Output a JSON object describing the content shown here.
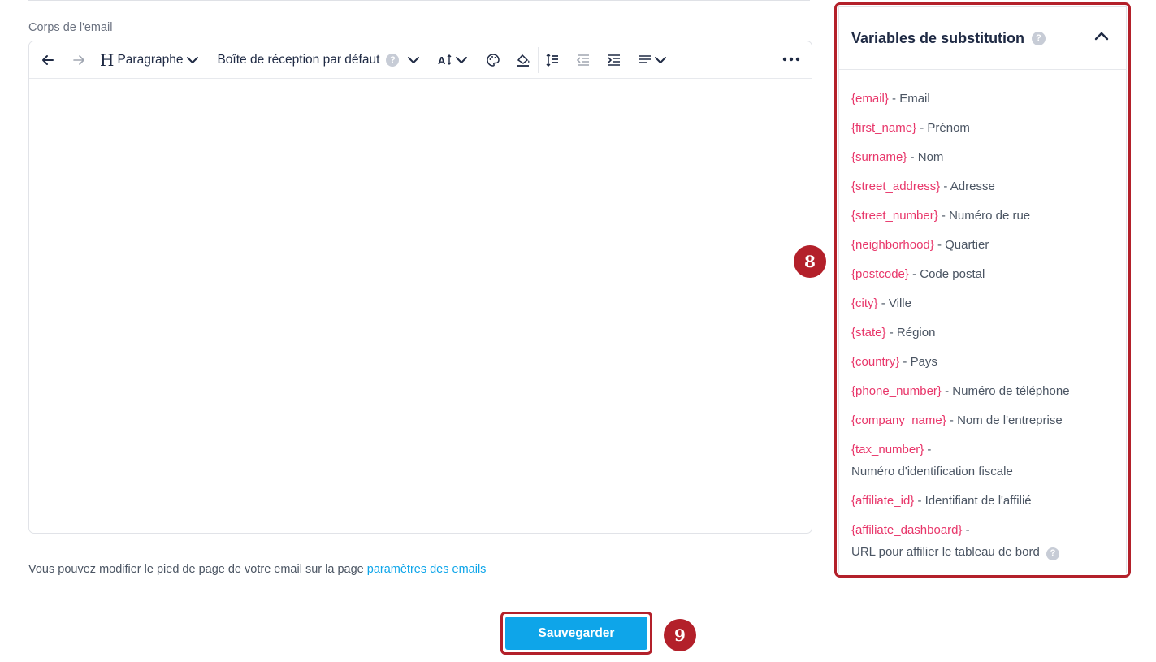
{
  "editor": {
    "label": "Corps de l'email",
    "toolbar": {
      "undo_icon": "arrow-left-icon",
      "redo_icon": "arrow-right-icon",
      "heading_icon": "heading-icon",
      "paragraph_label": "Paragraphe",
      "inbox_label": "Boîte de réception par défaut",
      "help_glyph": "?"
    }
  },
  "footer": {
    "text": "Vous pouvez modifier le pied de page de votre email sur la page",
    "link": "paramètres des emails"
  },
  "save_button": "Sauvegarder",
  "annotations": {
    "panel": "8",
    "save": "9"
  },
  "variables_panel": {
    "title": "Variables de substitution",
    "help_glyph": "?",
    "items": [
      {
        "token": "{email}",
        "desc": "Email"
      },
      {
        "token": "{first_name}",
        "desc": "Prénom"
      },
      {
        "token": "{surname}",
        "desc": "Nom"
      },
      {
        "token": "{street_address}",
        "desc": "Adresse"
      },
      {
        "token": "{street_number}",
        "desc": "Numéro de rue"
      },
      {
        "token": "{neighborhood}",
        "desc": "Quartier"
      },
      {
        "token": "{postcode}",
        "desc": "Code postal"
      },
      {
        "token": "{city}",
        "desc": "Ville"
      },
      {
        "token": "{state}",
        "desc": "Région"
      },
      {
        "token": "{country}",
        "desc": "Pays"
      },
      {
        "token": "{phone_number}",
        "desc": "Numéro de téléphone"
      },
      {
        "token": "{company_name}",
        "desc": "Nom de l'entreprise"
      },
      {
        "token": "{tax_number}",
        "desc": "Numéro d'identification fiscale"
      },
      {
        "token": "{affiliate_id}",
        "desc": "Identifiant de l'affilié"
      },
      {
        "token": "{affiliate_dashboard}",
        "desc": "URL pour affilier le tableau de bord"
      }
    ]
  },
  "colors": {
    "accent": "#0ea5e9",
    "token": "#e8366a",
    "annotation": "#b3202a"
  }
}
